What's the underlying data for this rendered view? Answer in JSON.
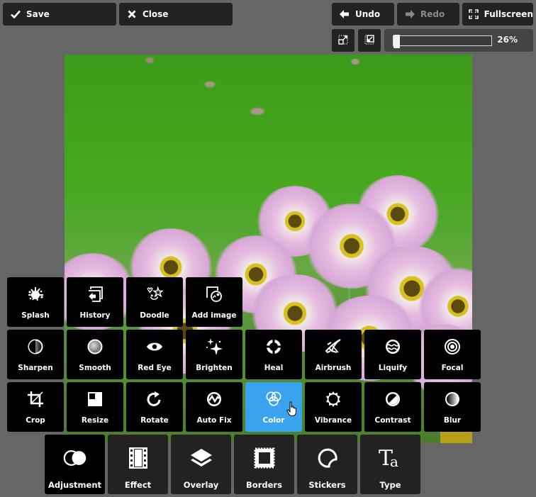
{
  "toolbar": {
    "save_label": "Save",
    "close_label": "Close",
    "undo_label": "Undo",
    "redo_label": "Redo",
    "fullscreen_label": "Fullscreen",
    "zoom_fit_icon": "zoom-fit-icon",
    "zoom_actual_icon": "zoom-actual-size-icon",
    "zoom_percent": 26,
    "zoom_label": "26%",
    "redo_disabled": true
  },
  "tools": [
    {
      "label": "Splash",
      "icon": "splash-icon"
    },
    {
      "label": "History",
      "icon": "history-icon"
    },
    {
      "label": "Doodle",
      "icon": "doodle-icon"
    },
    {
      "label": "Add image",
      "icon": "add-image-icon"
    },
    {
      "label": "Sharpen",
      "icon": "sharpen-icon"
    },
    {
      "label": "Smooth",
      "icon": "smooth-icon"
    },
    {
      "label": "Red Eye",
      "icon": "red-eye-icon"
    },
    {
      "label": "Brighten",
      "icon": "brighten-icon"
    },
    {
      "label": "Heal",
      "icon": "heal-icon"
    },
    {
      "label": "Airbrush",
      "icon": "airbrush-icon"
    },
    {
      "label": "Liquify",
      "icon": "liquify-icon"
    },
    {
      "label": "Focal",
      "icon": "focal-icon"
    },
    {
      "label": "Crop",
      "icon": "crop-icon"
    },
    {
      "label": "Resize",
      "icon": "resize-icon"
    },
    {
      "label": "Rotate",
      "icon": "rotate-icon"
    },
    {
      "label": "Auto Fix",
      "icon": "auto-fix-icon"
    },
    {
      "label": "Color",
      "icon": "color-icon",
      "active": true
    },
    {
      "label": "Vibrance",
      "icon": "vibrance-icon"
    },
    {
      "label": "Contrast",
      "icon": "contrast-icon"
    },
    {
      "label": "Blur",
      "icon": "blur-icon"
    }
  ],
  "categories": [
    {
      "label": "Adjustment",
      "icon": "adjustment-icon",
      "active": true
    },
    {
      "label": "Effect",
      "icon": "film-icon"
    },
    {
      "label": "Overlay",
      "icon": "layers-icon"
    },
    {
      "label": "Borders",
      "icon": "stamp-border-icon"
    },
    {
      "label": "Stickers",
      "icon": "sticker-icon"
    },
    {
      "label": "Type",
      "icon": "type-icon"
    }
  ],
  "colors": {
    "active_tool": "#3aa3f0",
    "background": "#666666",
    "button": "#222222"
  }
}
